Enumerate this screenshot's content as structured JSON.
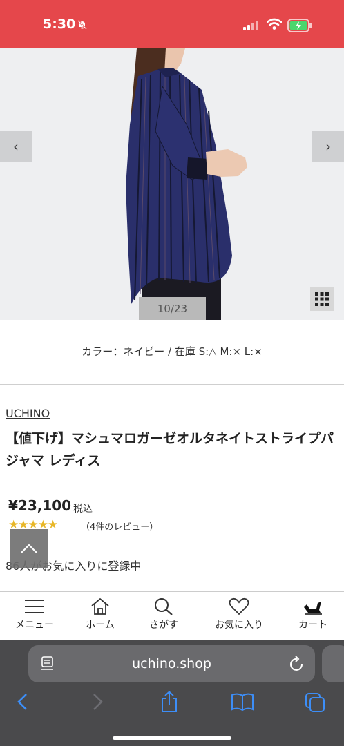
{
  "status_bar": {
    "time": "5:30",
    "color": "#e5474b"
  },
  "gallery": {
    "prev_label": "‹",
    "next_label": "›",
    "counter": "10/23"
  },
  "variant_text": "カラー：ネイビー / 在庫 S:△ M:× L:×",
  "product": {
    "brand": "UCHINO",
    "title": "【値下げ】マシュマロガーゼオルタネイトストライプパジャマ レディス",
    "price": "¥23,100",
    "tax_label": "税込",
    "stars": "★★★★★",
    "review_count": "（4件のレビュー）",
    "favorites": "86人がお気に入りに登録中"
  },
  "bottom_nav": {
    "items": [
      {
        "label": "メニュー",
        "icon": "menu-icon"
      },
      {
        "label": "ホーム",
        "icon": "home-icon"
      },
      {
        "label": "さがす",
        "icon": "search-icon"
      },
      {
        "label": "お気に入り",
        "icon": "heart-icon"
      },
      {
        "label": "カート",
        "icon": "cart-icon"
      }
    ]
  },
  "browser": {
    "url": "uchino.shop"
  }
}
